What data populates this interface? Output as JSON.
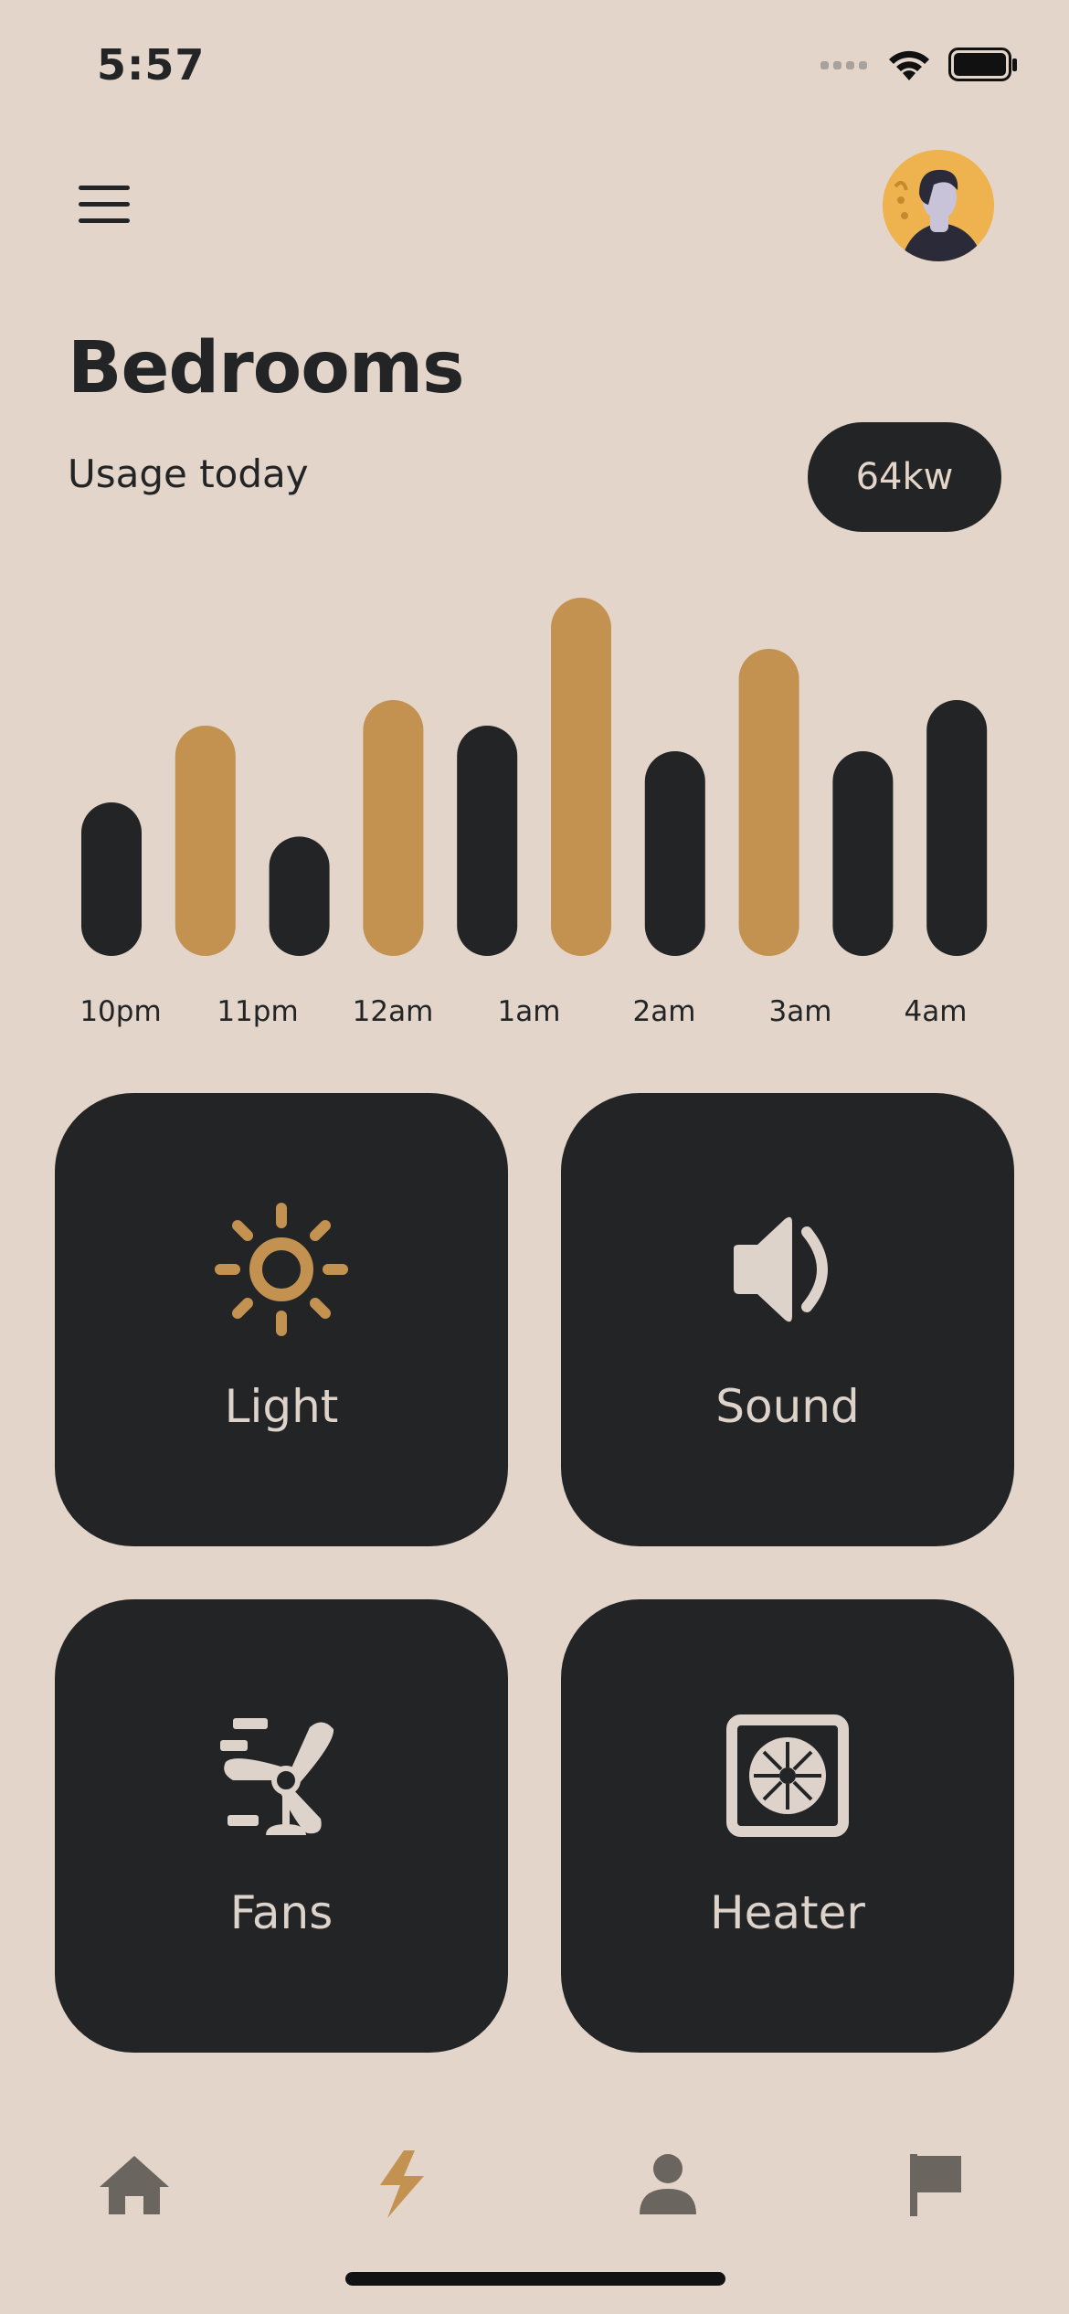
{
  "status_bar": {
    "time": "5:57"
  },
  "header": {
    "title": "Bedrooms"
  },
  "usage": {
    "label": "Usage today",
    "value": "64kw"
  },
  "chart_data": {
    "type": "bar",
    "categories": [
      "10pm",
      "11pm",
      "12am",
      "1am",
      "2am",
      "3am",
      "4am"
    ],
    "series": [
      {
        "values": [
          18,
          27,
          14,
          28,
          27,
          43,
          25,
          37,
          24,
          31
        ]
      }
    ],
    "bars": [
      {
        "value": 18,
        "color": "#222426"
      },
      {
        "value": 27,
        "color": "#C49250"
      },
      {
        "value": 14,
        "color": "#222426"
      },
      {
        "value": 30,
        "color": "#C49250"
      },
      {
        "value": 27,
        "color": "#222426"
      },
      {
        "value": 42,
        "color": "#C49250"
      },
      {
        "value": 24,
        "color": "#222426"
      },
      {
        "value": 36,
        "color": "#C49250"
      },
      {
        "value": 24,
        "color": "#222426"
      },
      {
        "value": 30,
        "color": "#222426"
      }
    ],
    "title": "",
    "xlabel": "",
    "ylabel": "",
    "ylim": [
      0,
      45
    ],
    "grid": false
  },
  "devices": [
    {
      "label": "Light",
      "icon": "sun-icon"
    },
    {
      "label": "Sound",
      "icon": "speaker-icon"
    },
    {
      "label": "Fans",
      "icon": "fan-icon"
    },
    {
      "label": "Heater",
      "icon": "heater-icon"
    }
  ],
  "nav": [
    {
      "icon": "home-icon"
    },
    {
      "icon": "lightning-icon",
      "active": true
    },
    {
      "icon": "person-icon"
    },
    {
      "icon": "flag-icon"
    }
  ],
  "colors": {
    "background": "#E3D5C9",
    "dark": "#222426",
    "accent": "#C49250",
    "tile_text": "#DDD3CB",
    "nav_inactive": "#6B6560"
  }
}
